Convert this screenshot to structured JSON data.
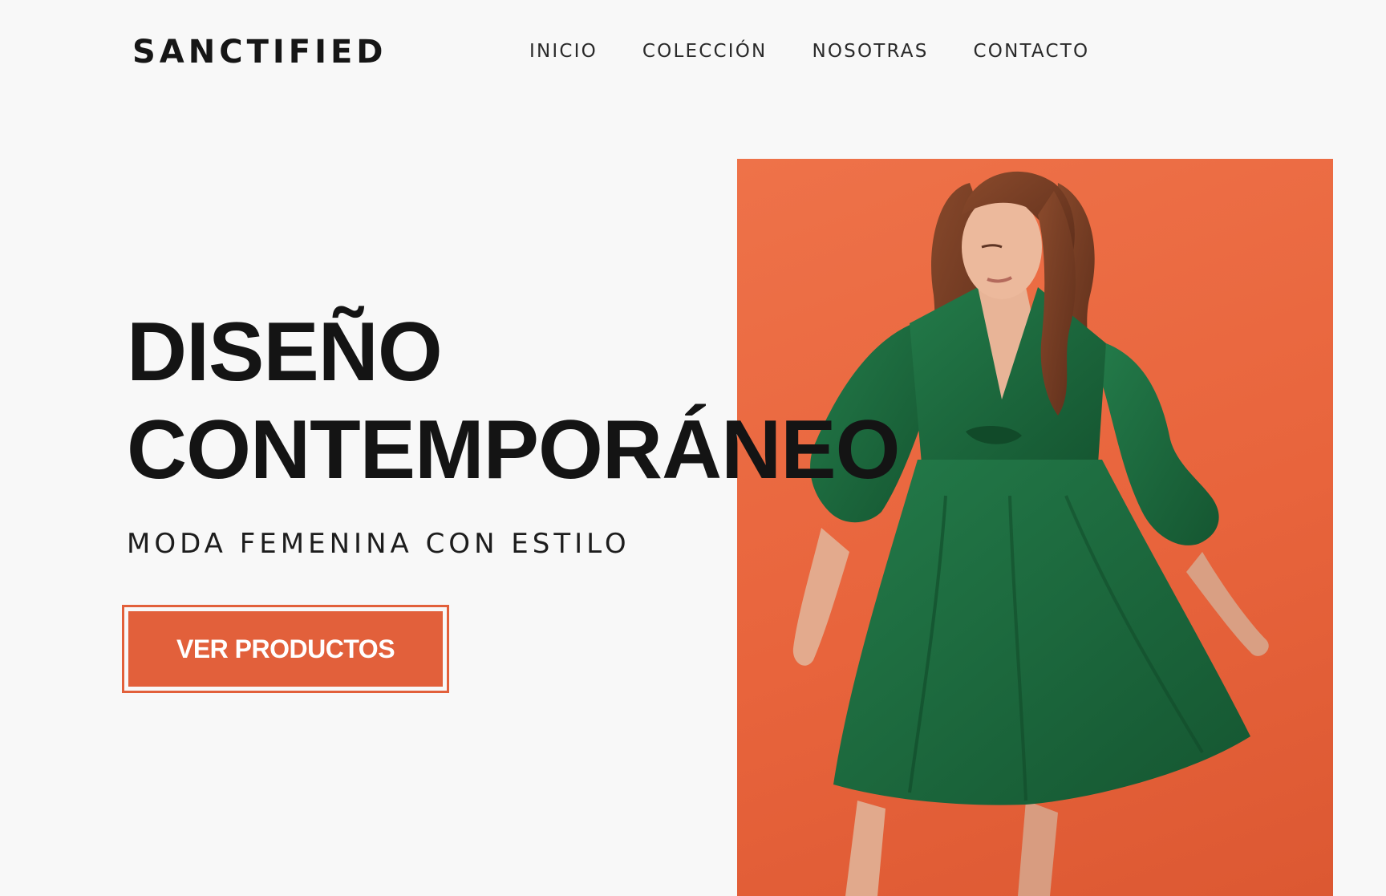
{
  "brand": {
    "name": "SANCTIFIED"
  },
  "nav": {
    "items": [
      "INICIO",
      "COLECCIÓN",
      "NOSOTRAS",
      "CONTACTO"
    ]
  },
  "hero": {
    "headline_line1": "DISEÑO",
    "headline_line2": "CONTEMPORÁNEO",
    "subtitle": "MODA FEMENINA CON ESTILO",
    "cta_label": "VER PRODUCTOS"
  },
  "colors": {
    "accent": "#e2603b",
    "image_background": "#ec6b44",
    "dress": "#1e6b40",
    "text": "#141414",
    "page_background": "#f8f8f8"
  }
}
